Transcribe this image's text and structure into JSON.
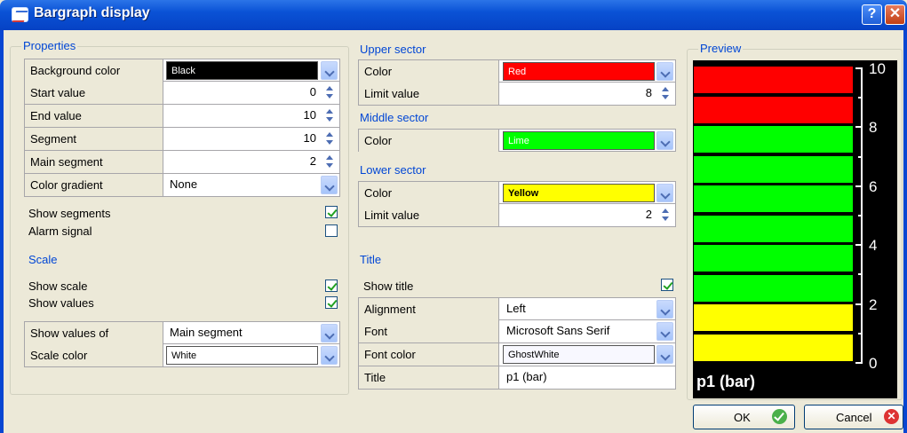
{
  "window": {
    "title": "Bargraph display"
  },
  "properties": {
    "group_label": "Properties",
    "rows": [
      {
        "label": "Background color",
        "value": "Black",
        "color": "#000000",
        "text_color": "#ffffff"
      },
      {
        "label": "Start value",
        "value": "0"
      },
      {
        "label": "End value",
        "value": "10"
      },
      {
        "label": "Segment",
        "value": "10"
      },
      {
        "label": "Main segment",
        "value": "2"
      },
      {
        "label": "Color gradient",
        "value": "None"
      }
    ],
    "show_segments": {
      "label": "Show segments",
      "checked": true
    },
    "alarm_signal": {
      "label": "Alarm signal",
      "checked": false
    }
  },
  "scale": {
    "heading": "Scale",
    "show_scale": {
      "label": "Show scale",
      "checked": true
    },
    "show_values": {
      "label": "Show values",
      "checked": true
    },
    "rows": [
      {
        "label": "Show values of",
        "value": "Main segment"
      },
      {
        "label": "Scale color",
        "value": "White",
        "color": "#ffffff"
      }
    ]
  },
  "upper_sector": {
    "heading": "Upper sector",
    "color_label": "Color",
    "color_value": "Red",
    "color": "#ff0000",
    "limit_label": "Limit value",
    "limit_value": "8"
  },
  "middle_sector": {
    "heading": "Middle sector",
    "color_label": "Color",
    "color_value": "Lime",
    "color": "#00ff00"
  },
  "lower_sector": {
    "heading": "Lower sector",
    "color_label": "Color",
    "color_value": "Yellow",
    "color": "#ffff00",
    "limit_label": "Limit value",
    "limit_value": "2"
  },
  "title_section": {
    "heading": "Title",
    "show_title": {
      "label": "Show title",
      "checked": true
    },
    "rows": [
      {
        "label": "Alignment",
        "value": "Left"
      },
      {
        "label": "Font",
        "value": "Microsoft Sans Serif"
      },
      {
        "label": "Font color",
        "value": "GhostWhite",
        "color": "#f8f8ff"
      },
      {
        "label": "Title",
        "value": "p1 (bar)"
      }
    ]
  },
  "preview": {
    "group_label": "Preview",
    "title": "p1 (bar)",
    "segments": [
      "#ff0000",
      "#ff0000",
      "#00ff00",
      "#00ff00",
      "#00ff00",
      "#00ff00",
      "#00ff00",
      "#00ff00",
      "#ffff00",
      "#ffff00"
    ],
    "scale_labels": [
      "10",
      "8",
      "6",
      "4",
      "2",
      "0"
    ]
  },
  "buttons": {
    "ok": "OK",
    "cancel": "Cancel"
  }
}
